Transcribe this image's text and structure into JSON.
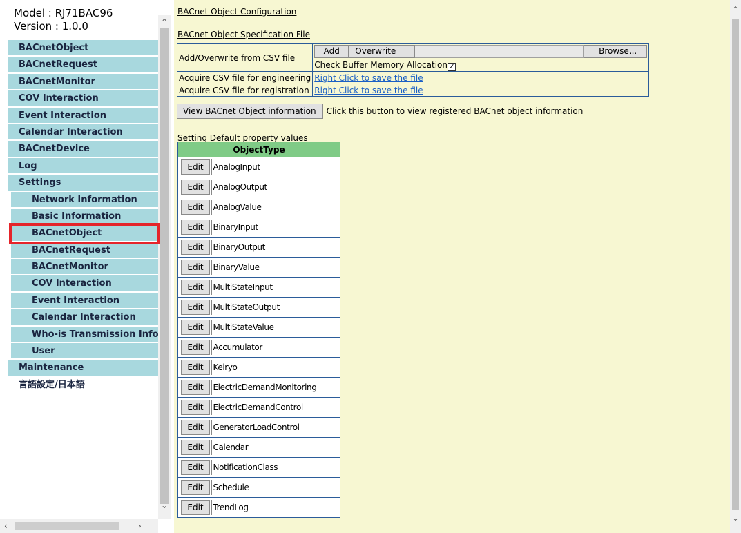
{
  "sidebar": {
    "model": "Model : RJ71BAC96",
    "version": "Version : 1.0.0",
    "items": [
      {
        "label": "BACnetObject",
        "level": 1
      },
      {
        "label": "BACnetRequest",
        "level": 1
      },
      {
        "label": "BACnetMonitor",
        "level": 1
      },
      {
        "label": "COV Interaction",
        "level": 1
      },
      {
        "label": "Event Interaction",
        "level": 1
      },
      {
        "label": "Calendar Interaction",
        "level": 1
      },
      {
        "label": "BACnetDevice",
        "level": 1
      },
      {
        "label": "Log",
        "level": 1
      },
      {
        "label": "Settings",
        "level": 1
      },
      {
        "label": "Network Information",
        "level": 2
      },
      {
        "label": "Basic Information",
        "level": 2
      },
      {
        "label": "BACnetObject",
        "level": 2,
        "selected": true
      },
      {
        "label": "BACnetRequest",
        "level": 2
      },
      {
        "label": "BACnetMonitor",
        "level": 2
      },
      {
        "label": "COV Interaction",
        "level": 2
      },
      {
        "label": "Event Interaction",
        "level": 2
      },
      {
        "label": "Calendar Interaction",
        "level": 2
      },
      {
        "label": "Who-is Transmission Info.",
        "level": 2
      },
      {
        "label": "User",
        "level": 2
      },
      {
        "label": "Maintenance",
        "level": 1
      },
      {
        "label": "言語設定/日本語",
        "level": 1,
        "plain": true
      }
    ],
    "highlight_color": "#e5242a"
  },
  "main": {
    "title": "BACnet Object Configuration",
    "spec_file_title": "BACnet Object Specification File",
    "csv": {
      "add_overwrite_label": "Add/Overwrite from CSV file",
      "add_button": "Add",
      "overwrite_button": "Overwrite",
      "browse_button": "Browse...",
      "check_label": "Check Buffer Memory Allocation",
      "check_checked": true,
      "acquire_engineering_label": "Acquire CSV file for engineering",
      "acquire_registration_label": "Acquire CSV file for registration",
      "save_link": "Right Click to save the file"
    },
    "view_button": "View BACnet Object information",
    "view_note": "Click this button to view registered BACnet object information",
    "default_title": "Setting Default property values",
    "table": {
      "header": "ObjectType",
      "edit_label": "Edit",
      "rows": [
        "AnalogInput",
        "AnalogOutput",
        "AnalogValue",
        "BinaryInput",
        "BinaryOutput",
        "BinaryValue",
        "MultiStateInput",
        "MultiStateOutput",
        "MultiStateValue",
        "Accumulator",
        "Keiryo",
        "ElectricDemandMonitoring",
        "ElectricDemandControl",
        "GeneratorLoadControl",
        "Calendar",
        "NotificationClass",
        "Schedule",
        "TrendLog"
      ]
    }
  },
  "colors": {
    "nav_bg": "#a8d8de",
    "content_bg": "#f7f7d2",
    "table_header_bg": "#7fcb86",
    "border": "#2b5c9a",
    "link": "#1a5fc5"
  }
}
